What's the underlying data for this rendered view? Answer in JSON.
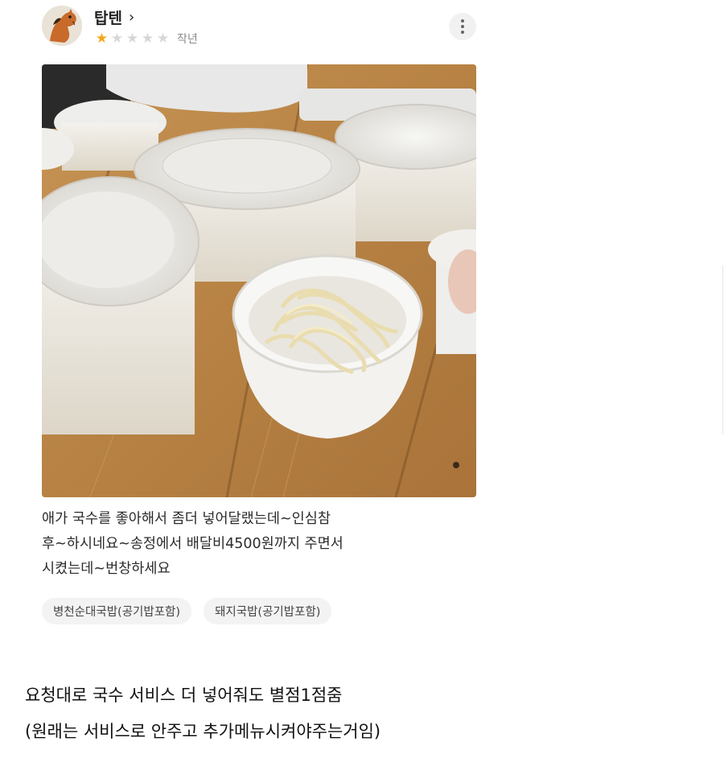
{
  "review": {
    "reviewer_name": "탑텐",
    "reviewer_chevron": "›",
    "rating": 1,
    "rating_max": 5,
    "time_ago": "작년",
    "more_icon": "more-vertical-icon",
    "text_lines": [
      "애가 국수를 좋아해서 좀더 넣어달랬는데~인심참",
      "후~하시네요~송정에서 배달비4500원까지 주면서",
      "시켰는데~번창하세요"
    ],
    "menu_tags": [
      "병천순대국밥(공기밥포함)",
      "돼지국밥(공기밥포함)"
    ],
    "star_color": "#f5a816"
  },
  "caption": {
    "line1": "요청대로 국수 서비스 더 넣어줘도 별점1점줌",
    "line2": "(원래는 서비스로 안주고 추가메뉴시켜야주는거임)"
  }
}
